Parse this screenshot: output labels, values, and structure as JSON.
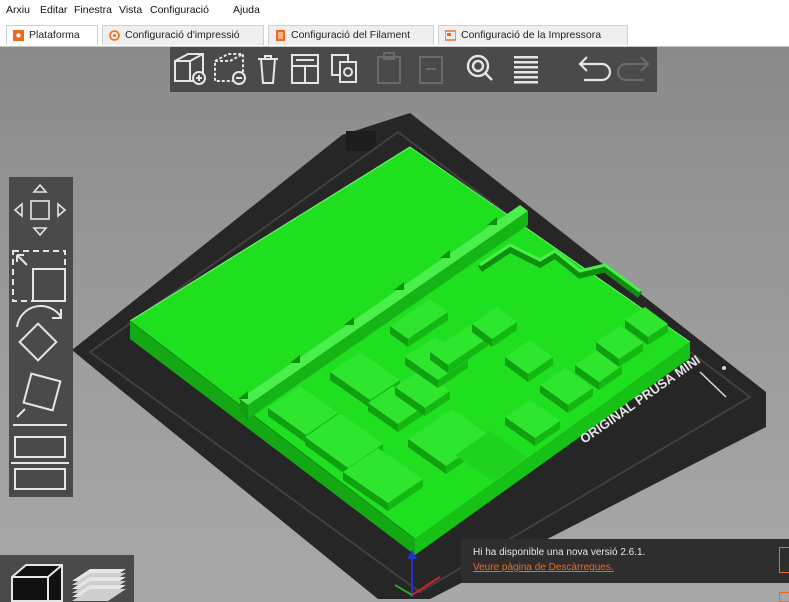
{
  "menu": [
    "Arxiu",
    "Editar",
    "Finestra",
    "Vista",
    "Configuració",
    "Ajuda"
  ],
  "tabs": [
    {
      "label": "Plataforma",
      "icon": "plater-icon",
      "active": true
    },
    {
      "label": "Configuració d'impressió",
      "icon": "print-settings-icon"
    },
    {
      "label": "Configuració del Filament",
      "icon": "filament-settings-icon"
    },
    {
      "label": "Configuració de la Impressora",
      "icon": "printer-settings-icon"
    }
  ],
  "toolbar": [
    "add-object",
    "delete-object",
    "delete-all",
    "arrange",
    "copy",
    "paste",
    "instance",
    "search",
    "layers-editing",
    "undo",
    "redo"
  ],
  "sidebar_tools": [
    "move",
    "scale",
    "rotate",
    "place-on-face",
    "cut"
  ],
  "bed_label": "ORIGINAL PRUSA MINI",
  "notification": {
    "message": "Hi ha disponible una nova versió 2.6.1.",
    "link": "Veure pàgina de Descàrregues."
  },
  "colors": {
    "model": "#1fe01f",
    "bed": "#2b2b2b",
    "accent": "#ed6b21",
    "panel": "#4a4a4a"
  }
}
